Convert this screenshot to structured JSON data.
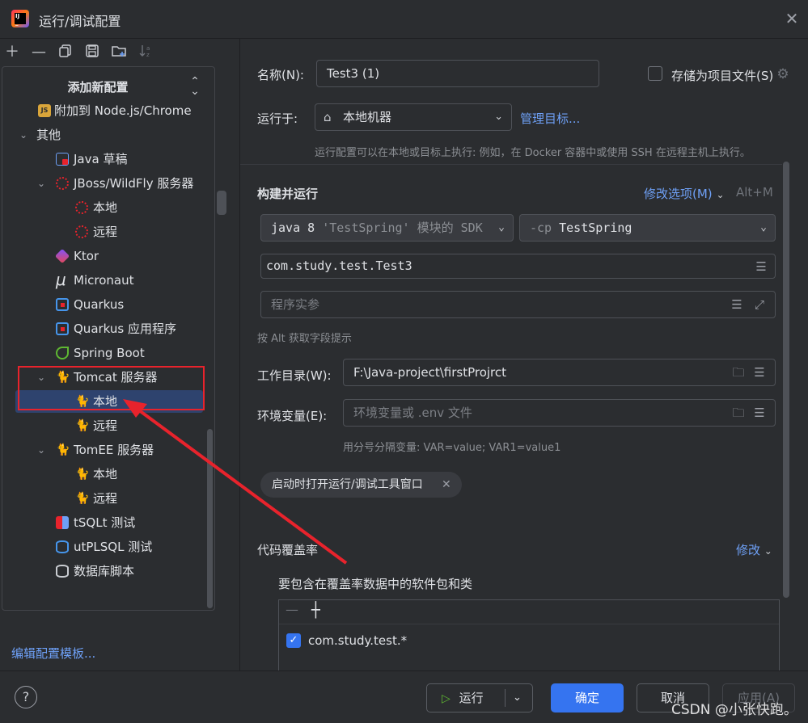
{
  "window": {
    "title": "运行/调试配置"
  },
  "left_toolbar": {
    "icons": [
      "add-icon",
      "remove-icon",
      "copy-icon",
      "save-icon",
      "new-folder-icon",
      "sort-icon"
    ]
  },
  "left_panel": {
    "title": "添加新配置",
    "items": [
      {
        "label": "附加到 Node.js/Chrome",
        "icon": "js-icon"
      },
      {
        "label": "其他",
        "icon": "none",
        "expanded": true
      },
      {
        "label": "Java 草稿",
        "icon": "java-scratch-icon"
      },
      {
        "label": "JBoss/WildFly 服务器",
        "icon": "jboss-icon",
        "expanded": true
      },
      {
        "label": "本地",
        "icon": "jboss-icon"
      },
      {
        "label": "远程",
        "icon": "jboss-icon"
      },
      {
        "label": "Ktor",
        "icon": "ktor-icon"
      },
      {
        "label": "Micronaut",
        "icon": "micronaut-icon"
      },
      {
        "label": "Quarkus",
        "icon": "quarkus-icon"
      },
      {
        "label": "Quarkus 应用程序",
        "icon": "quarkus-icon"
      },
      {
        "label": "Spring Boot",
        "icon": "spring-boot-icon"
      },
      {
        "label": "Tomcat 服务器",
        "icon": "tomcat-icon",
        "expanded": true
      },
      {
        "label": "本地",
        "icon": "tomcat-icon",
        "selected": true
      },
      {
        "label": "远程",
        "icon": "tomcat-icon"
      },
      {
        "label": "TomEE 服务器",
        "icon": "tomee-icon",
        "expanded": true
      },
      {
        "label": "本地",
        "icon": "tomee-icon"
      },
      {
        "label": "远程",
        "icon": "tomee-icon"
      },
      {
        "label": "tSQLt 测试",
        "icon": "tsqlt-icon"
      },
      {
        "label": "utPLSQL 测试",
        "icon": "utplsql-icon"
      },
      {
        "label": "数据库脚本",
        "icon": "database-script-icon"
      }
    ],
    "edit_templates_link": "编辑配置模板..."
  },
  "form": {
    "name_label": "名称(N):",
    "name_value": "Test3 (1)",
    "store_label": "存储为项目文件(S)",
    "store_checked": false,
    "run_on_label": "运行于:",
    "run_on_value": "本地机器",
    "manage_targets": "管理目标...",
    "run_on_hint": "运行配置可以在本地或目标上执行: 例如，在 Docker 容器中或使用 SSH 在远程主机上执行。",
    "build_run_title": "构建并运行",
    "modify_options": "修改选项(M)",
    "modify_shortcut": "Alt+M",
    "sdk_value_prefix": "java 8",
    "sdk_value_module": "'TestSpring'",
    "sdk_value_suffix": "模块的 SDK",
    "classpath_prefix": "-cp",
    "classpath_value": "TestSpring",
    "main_class": "com.study.test.Test3",
    "program_args_placeholder": "程序实参",
    "alt_hint": "按 Alt 获取字段提示",
    "workdir_label": "工作目录(W):",
    "workdir_value": "F:\\Java-project\\firstProjrct",
    "env_label": "环境变量(E):",
    "env_placeholder": "环境变量或 .env 文件",
    "env_hint": "用分号分隔变量: VAR=value; VAR1=value1",
    "launch_chip": "启动时打开运行/调试工具窗口",
    "coverage_title": "代码覆盖率",
    "coverage_modify": "修改",
    "coverage_packages_label": "要包含在覆盖率数据中的软件包和类",
    "coverage_entries": [
      {
        "pattern": "com.study.test.*",
        "checked": true
      }
    ]
  },
  "buttons": {
    "run": "运行",
    "ok": "确定",
    "cancel": "取消",
    "apply": "应用(A)"
  },
  "watermark": "CSDN @小张快跑。",
  "colors": {
    "accent": "#3574f0",
    "link": "#6ea0f6",
    "highlight": "#e8232c",
    "background": "#2b2d30"
  }
}
